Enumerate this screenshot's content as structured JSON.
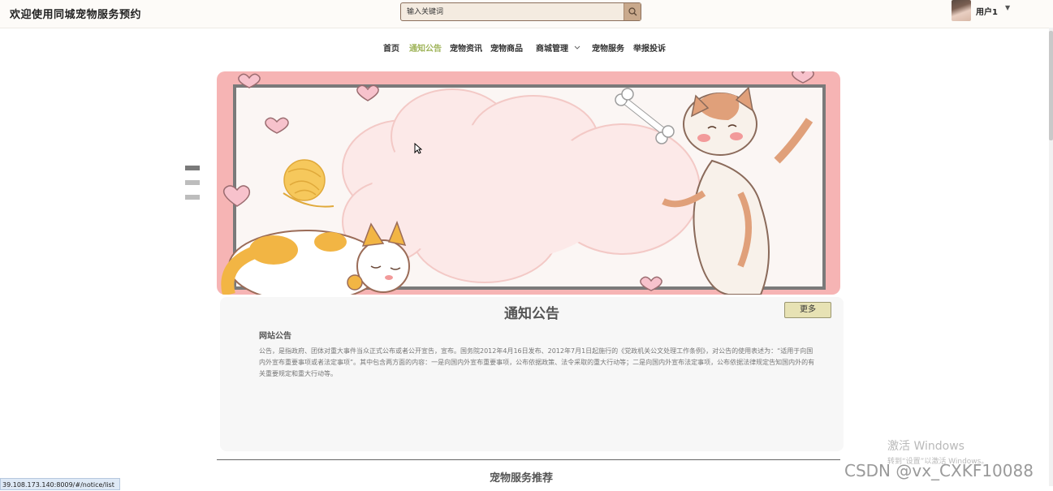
{
  "header": {
    "site_title": "欢迎使用同城宠物服务预约",
    "search_placeholder": "输入关键词",
    "user_name": "用户1"
  },
  "nav": {
    "items": [
      {
        "label": "首页",
        "active": false
      },
      {
        "label": "通知公告",
        "active": true
      },
      {
        "label": "宠物资讯",
        "active": false
      },
      {
        "label": "宠物商品",
        "active": false
      },
      {
        "label": "商城管理",
        "active": false
      },
      {
        "label": "宠物服务",
        "active": false
      },
      {
        "label": "举报投诉",
        "active": false
      }
    ]
  },
  "carousel": {
    "slide_count": 3,
    "active_index": 0
  },
  "notice": {
    "heading": "通知公告",
    "more_label": "更多",
    "item_title": "网站公告",
    "item_content": "公告，是指政府、团体对重大事件当众正式公布或者公开宣告，宣布。国务院2012年4月16日发布、2012年7月1日起施行的《党政机关公文处理工作条例》，对公告的使用表述为：“适用于向国内外宣布重要事项或者法定事项”。其中包含两方面的内容：一是向国内外宣布重要事项，公布依据政策、法令采取的重大行动等；二是向国内外宣布法定事项，公布依据法律规定告知国内外的有关重要规定和重大行动等。"
  },
  "recommend": {
    "title": "宠物服务推荐"
  },
  "status_bar": {
    "url": "39.108.173.140:8009/#/notice/list"
  },
  "watermark": {
    "windows_title": "激活 Windows",
    "windows_sub": "转到“设置”以激活 Windows。",
    "csdn": "CSDN @vx_CXKF10088"
  },
  "colors": {
    "accent": "#9fb45a",
    "banner_pink": "#f6b4b4",
    "more_button": "#e7e2b4"
  }
}
